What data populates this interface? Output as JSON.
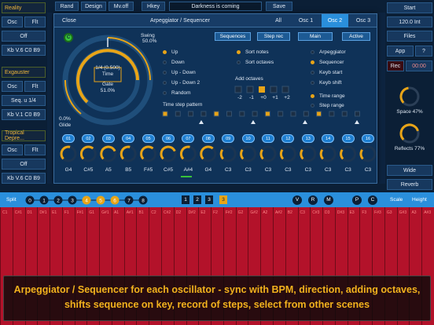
{
  "left": {
    "reality": "Reality",
    "osc": "Osc",
    "flt": "Flt",
    "off": "Off",
    "kb1": "Kb V.6 C0 B9",
    "exgauster": "Exgauster",
    "seq": "Seq. u 1/4",
    "kb2": "Kb V.1 C0 B9",
    "tropical": "Tropical Depre...",
    "kb3": "Kb V.6 C0 B9"
  },
  "topbar": {
    "rand": "Rand",
    "design": "Design",
    "mvoff": "Mv.off",
    "hkey": "Hkey",
    "scene": "Darkness is coming",
    "save": "Save"
  },
  "right": {
    "start": "Start",
    "bpm": "120.0 Int",
    "files": "Files",
    "app": "App",
    "help": "?",
    "rec": "Rec",
    "time": "00:00",
    "space": "Space 47%",
    "reflects": "Reflects 77%",
    "wide": "Wide",
    "reverb": "Reverb",
    "space_level": 0.47,
    "reflects_level": 0.77
  },
  "panel": {
    "close": "Close",
    "title": "Arpeggiator / Sequencer",
    "tabs": [
      "All",
      "Osc 1",
      "Osc 2",
      "Osc 3"
    ],
    "active_tab": 2,
    "c_badge": "C",
    "swing_label": "Swing",
    "swing_value": "50.0%",
    "time_value": "1/4 (0.500)",
    "time_label": "Time",
    "gate_label": "Gate",
    "gate_value": "51.0%",
    "glide_value": "0.0%",
    "glide_label": "Glide",
    "sequences": "Sequences",
    "step_rec": "Step rec",
    "main": "Main",
    "active": "Active",
    "directions": [
      "Up",
      "Down",
      "Up - Down",
      "Up - Down 2",
      "Random"
    ],
    "direction_selected": [
      true,
      false,
      false,
      false,
      false
    ],
    "sort_notes": "Sort notes",
    "sort_octaves": "Sort octaves",
    "add_octaves": "Add octaves",
    "octave_values": [
      "-2",
      "-1",
      "+0",
      "+1",
      "+2"
    ],
    "mode_opts": [
      "Arpeggiator",
      "Sequencer",
      "Keyb start",
      "Keyb shift"
    ],
    "mode_selected": [
      false,
      true,
      false,
      false
    ],
    "time_range": "Time range",
    "step_range": "Step range",
    "time_step_pattern": "Time step pattern",
    "steps": [
      "01",
      "02",
      "03",
      "04",
      "05",
      "06",
      "07",
      "08",
      "09",
      "10",
      "11",
      "12",
      "13",
      "14",
      "15",
      "16"
    ],
    "notes": [
      "G4",
      "C#5",
      "A5",
      "B5",
      "F#5",
      "C#5",
      "A#4",
      "G4",
      "C3",
      "C3",
      "C3",
      "C3",
      "C3",
      "C3",
      "C3",
      "C3"
    ],
    "colors": {
      "accent": "#e8a417",
      "blue": "#2a8fdc"
    }
  },
  "keyboard": {
    "split": "Split",
    "seq_numbers": [
      "0",
      "1",
      "2",
      "3",
      "4",
      "5",
      "6",
      "7",
      "8"
    ],
    "slots": [
      "1",
      "2",
      "3"
    ],
    "active_slot": "3",
    "letters": [
      "V",
      "R",
      "M",
      "P",
      "C"
    ],
    "scale": "Scale",
    "height": "Height",
    "keys": [
      "C1",
      "C#1",
      "D1",
      "D#1",
      "E1",
      "F1",
      "F#1",
      "G1",
      "G#1",
      "A1",
      "A#1",
      "B1",
      "C2",
      "C#2",
      "D2",
      "D#2",
      "E2",
      "F2",
      "F#2",
      "G2",
      "G#2",
      "A2",
      "A#2",
      "B2",
      "C3",
      "C#3",
      "D3",
      "D#3",
      "E3",
      "F3",
      "F#3",
      "G3",
      "G#3",
      "A3",
      "A#3"
    ]
  },
  "caption": "Arpeggiator / Sequencer for each oscillator - sync with BPM, direction, adding octaves, shifts sequence on key, record of steps, select from other scenes"
}
